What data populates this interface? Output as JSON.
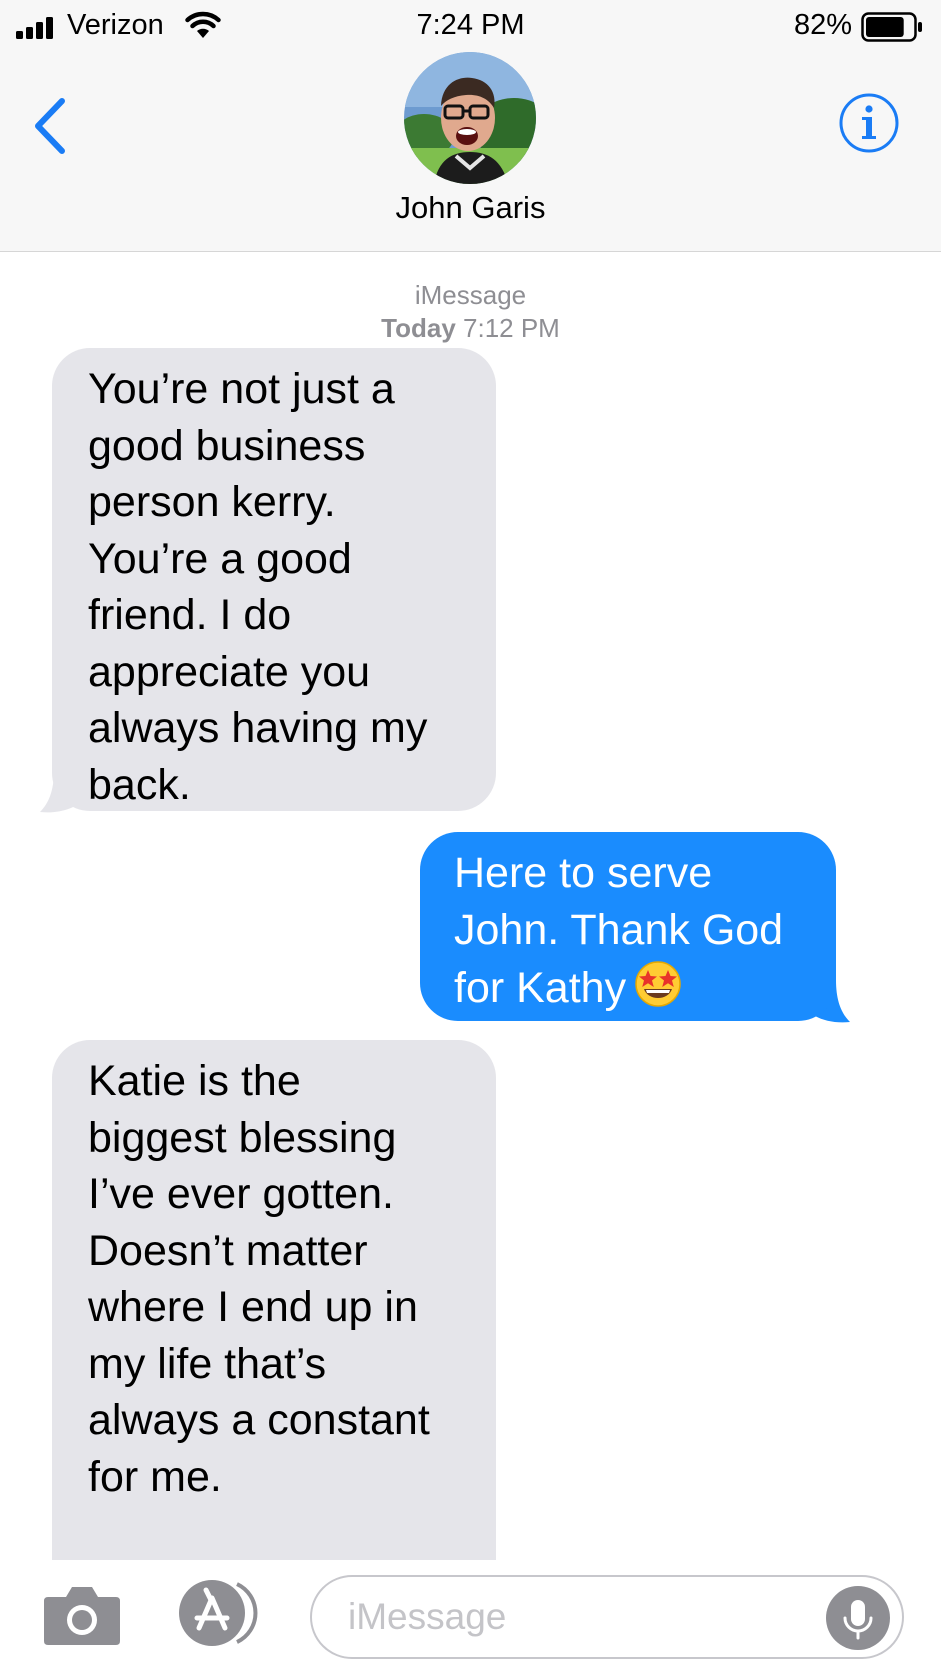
{
  "status_bar": {
    "carrier": "Verizon",
    "time": "7:24 PM",
    "battery_percent": "82%",
    "battery_level": 0.82
  },
  "header": {
    "contact_name": "John Garis",
    "back_icon": "chevron-left-icon",
    "info_icon": "info-icon"
  },
  "conversation": {
    "service": "iMessage",
    "timestamp_day": "Today",
    "timestamp_time": "7:12 PM",
    "messages": [
      {
        "direction": "incoming",
        "lines": [
          "You’re not just a",
          "good business",
          "person kerry.",
          "You’re a good",
          "friend. I do",
          "appreciate you",
          "always having my",
          "back."
        ]
      },
      {
        "direction": "outgoing",
        "lines": [
          "Here to serve",
          "John. Thank God",
          "for Kathy"
        ],
        "emoji": "star-struck-emoji"
      },
      {
        "direction": "incoming",
        "lines": [
          "Katie is the",
          "biggest blessing",
          "I’ve ever gotten.",
          "Doesn’t matter",
          "where I end up in",
          "my life that’s",
          "always a constant",
          "for me."
        ]
      }
    ]
  },
  "composer": {
    "placeholder": "iMessage",
    "value": "",
    "camera_icon": "camera-icon",
    "apps_icon": "app-store-icon",
    "mic_icon": "microphone-icon"
  },
  "colors": {
    "accent_blue": "#1a8cfe",
    "incoming_bubble": "#e5e5ea",
    "meta_gray": "#8e8e93",
    "header_bg": "#f7f7f7"
  }
}
